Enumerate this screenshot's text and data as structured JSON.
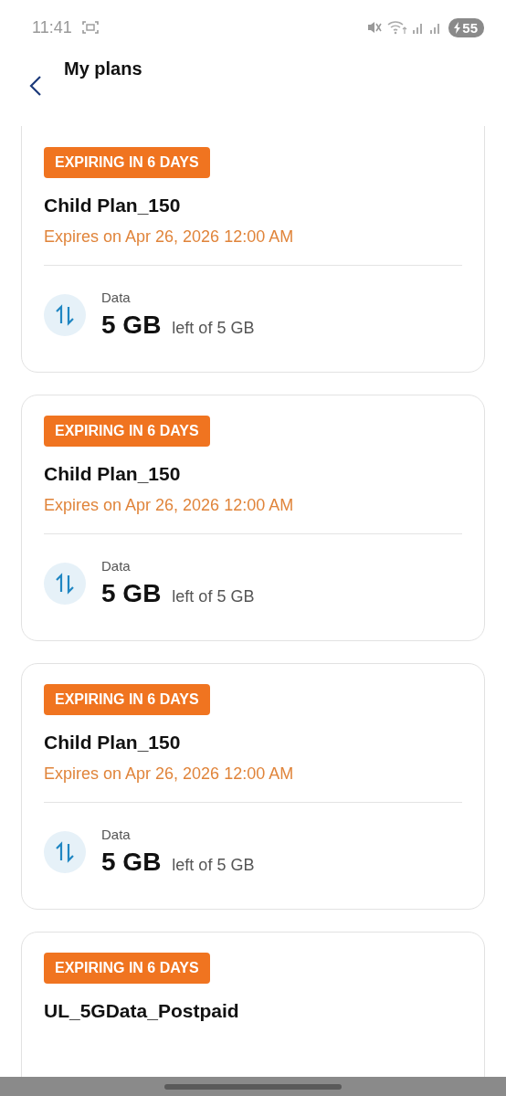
{
  "status_bar": {
    "time": "11:41",
    "battery": "55",
    "charging": true
  },
  "header": {
    "title": "My plans"
  },
  "plans": [
    {
      "badge": "EXPIRING IN 6 DAYS",
      "name": "Child Plan_150",
      "expiry": "Expires on Apr 26, 2026 12:00 AM",
      "usage_label": "Data",
      "remaining": "5 GB",
      "total": "left of 5 GB"
    },
    {
      "badge": "EXPIRING IN 6 DAYS",
      "name": "Child Plan_150",
      "expiry": "Expires on Apr 26, 2026 12:00 AM",
      "usage_label": "Data",
      "remaining": "5 GB",
      "total": "left of 5 GB"
    },
    {
      "badge": "EXPIRING IN 6 DAYS",
      "name": "Child Plan_150",
      "expiry": "Expires on Apr 26, 2026 12:00 AM",
      "usage_label": "Data",
      "remaining": "5 GB",
      "total": "left of 5 GB"
    },
    {
      "badge": "EXPIRING IN 6 DAYS",
      "name": "UL_5GData_Postpaid"
    }
  ]
}
